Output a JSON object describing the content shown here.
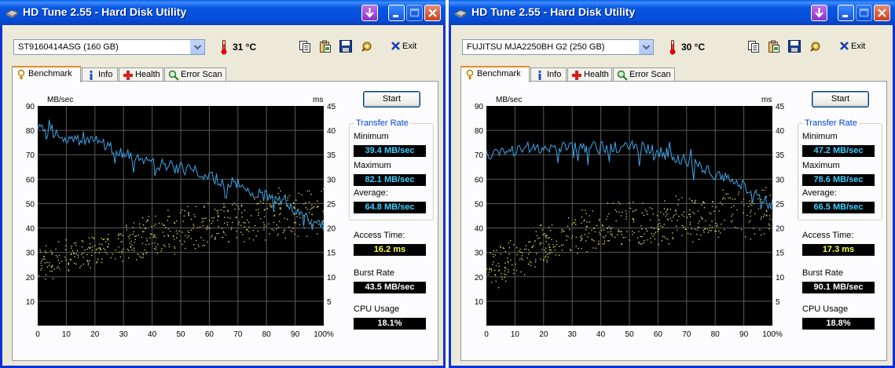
{
  "windows": [
    {
      "title": "HD Tune 2.55 - Hard Disk Utility",
      "drive": "ST9160414ASG (160 GB)",
      "temperature": "31 °C",
      "exit_label": "Exit",
      "tabs": [
        "Benchmark",
        "Info",
        "Health",
        "Error Scan"
      ],
      "start_label": "Start",
      "transfer_rate_title": "Transfer Rate",
      "stats": {
        "minimum_label": "Minimum",
        "minimum": "39.4 MB/sec",
        "maximum_label": "Maximum",
        "maximum": "82.1 MB/sec",
        "average_label": "Average:",
        "average": "64.8 MB/sec",
        "access_label": "Access Time:",
        "access": "16.2 ms",
        "burst_label": "Burst Rate",
        "burst": "43.5 MB/sec",
        "cpu_label": "CPU Usage",
        "cpu": "18.1%"
      },
      "chart_data": {
        "type": "line",
        "ylabel_left": "MB/sec",
        "ylabel_right": "ms",
        "x_ticks": [
          "0",
          "10",
          "20",
          "30",
          "40",
          "50",
          "60",
          "70",
          "80",
          "90",
          "100%"
        ],
        "y_ticks_left": [
          "10",
          "20",
          "30",
          "40",
          "50",
          "60",
          "70",
          "80",
          "90"
        ],
        "y_ticks_right": [
          "5",
          "10",
          "15",
          "20",
          "25",
          "30",
          "35",
          "40",
          "45"
        ],
        "xlim": [
          0,
          100
        ],
        "ylim_left": [
          0,
          90
        ],
        "ylim_right": [
          0,
          45
        ],
        "grid": true,
        "line_color": "#3ca6e8",
        "point_color": "#e8e860",
        "transfer_rate": [
          [
            0,
            80
          ],
          [
            5,
            79
          ],
          [
            10,
            77
          ],
          [
            15,
            76
          ],
          [
            20,
            76
          ],
          [
            25,
            73
          ],
          [
            30,
            71
          ],
          [
            35,
            69
          ],
          [
            40,
            66
          ],
          [
            45,
            66
          ],
          [
            50,
            64
          ],
          [
            55,
            63
          ],
          [
            60,
            61
          ],
          [
            65,
            59
          ],
          [
            70,
            58
          ],
          [
            75,
            55
          ],
          [
            80,
            53
          ],
          [
            85,
            51
          ],
          [
            90,
            47
          ],
          [
            95,
            44
          ],
          [
            100,
            41
          ]
        ],
        "access_time_band": [
          [
            0,
            10,
            15
          ],
          [
            20,
            13,
            18
          ],
          [
            40,
            15,
            22
          ],
          [
            60,
            17,
            25
          ],
          [
            80,
            18,
            27
          ],
          [
            100,
            19,
            28
          ]
        ]
      }
    },
    {
      "title": "HD Tune 2.55 - Hard Disk Utility",
      "drive": "FUJITSU MJA2250BH G2 (250 GB)",
      "temperature": "30 °C",
      "exit_label": "Exit",
      "tabs": [
        "Benchmark",
        "Info",
        "Health",
        "Error Scan"
      ],
      "start_label": "Start",
      "transfer_rate_title": "Transfer Rate",
      "stats": {
        "minimum_label": "Minimum",
        "minimum": "47.2 MB/sec",
        "maximum_label": "Maximum",
        "maximum": "78.6 MB/sec",
        "average_label": "Average:",
        "average": "66.5 MB/sec",
        "access_label": "Access Time:",
        "access": "17.3 ms",
        "burst_label": "Burst Rate",
        "burst": "90.1 MB/sec",
        "cpu_label": "CPU Usage",
        "cpu": "18.8%"
      },
      "chart_data": {
        "type": "line",
        "ylabel_left": "MB/sec",
        "ylabel_right": "ms",
        "x_ticks": [
          "0",
          "10",
          "20",
          "30",
          "40",
          "50",
          "60",
          "70",
          "80",
          "90",
          "100%"
        ],
        "y_ticks_left": [
          "10",
          "20",
          "30",
          "40",
          "50",
          "60",
          "70",
          "80",
          "90"
        ],
        "y_ticks_right": [
          "5",
          "10",
          "15",
          "20",
          "25",
          "30",
          "35",
          "40",
          "45"
        ],
        "xlim": [
          0,
          100
        ],
        "ylim_left": [
          0,
          90
        ],
        "ylim_right": [
          0,
          45
        ],
        "grid": true,
        "line_color": "#3ca6e8",
        "point_color": "#e8e860",
        "transfer_rate": [
          [
            0,
            70
          ],
          [
            5,
            71
          ],
          [
            10,
            72
          ],
          [
            15,
            73
          ],
          [
            20,
            72
          ],
          [
            25,
            73
          ],
          [
            30,
            73
          ],
          [
            35,
            74
          ],
          [
            40,
            73
          ],
          [
            45,
            73
          ],
          [
            50,
            74
          ],
          [
            55,
            73
          ],
          [
            60,
            71
          ],
          [
            65,
            70
          ],
          [
            70,
            67
          ],
          [
            75,
            65
          ],
          [
            80,
            62
          ],
          [
            85,
            60
          ],
          [
            90,
            57
          ],
          [
            95,
            53
          ],
          [
            100,
            49
          ]
        ],
        "access_time_band": [
          [
            0,
            8,
            14
          ],
          [
            20,
            13,
            20
          ],
          [
            40,
            16,
            24
          ],
          [
            60,
            17,
            26
          ],
          [
            80,
            18,
            27
          ],
          [
            100,
            19,
            28
          ]
        ]
      }
    }
  ]
}
